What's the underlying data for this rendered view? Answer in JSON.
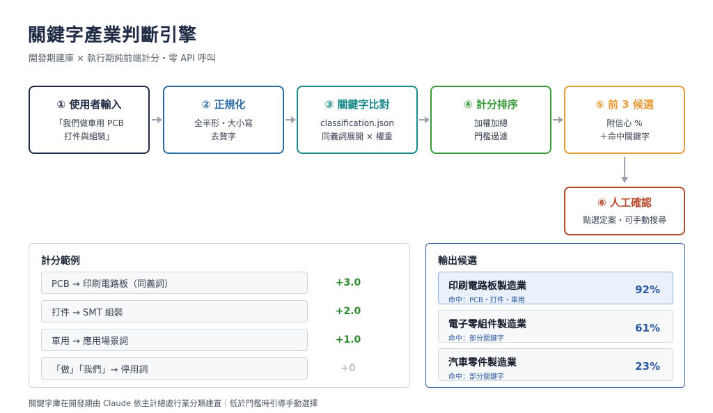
{
  "header": {
    "title": "關鍵字產業判斷引擎",
    "subtitle": "開發期建庫 × 執行期純前端計分・零 API 呼叫"
  },
  "colors": {
    "step1": "#1f2a44",
    "step2": "#2e6da4",
    "step3": "#1a8a8a",
    "step4": "#3a9a3a",
    "step5": "#e69a38",
    "step6": "#b5492c",
    "arrow": "#9ca3af",
    "positive": "#2f8a2f",
    "neutral": "#9aa0a6",
    "output_border": "#2c5aa0",
    "output_accent": "#2c5aa0"
  },
  "steps": [
    {
      "title": "① 使用者輸入",
      "lines": [
        "「我們做車用 PCB",
        "打件與組裝」"
      ]
    },
    {
      "title": "② 正規化",
      "lines": [
        "全半形・大小寫",
        "去贅字"
      ]
    },
    {
      "title": "③ 關鍵字比對",
      "lines": [
        "classification.json",
        "同義詞展開 × 權重"
      ]
    },
    {
      "title": "④ 計分排序",
      "lines": [
        "加權加總",
        "門檻過濾"
      ]
    },
    {
      "title": "⑤ 前 3 候選",
      "lines": [
        "附信心 %",
        "＋命中關鍵字"
      ]
    },
    {
      "title": "⑥ 人工確認",
      "lines": [
        "點選定案・可手動搜尋"
      ]
    }
  ],
  "scoring": {
    "heading": "計分範例",
    "rows": [
      {
        "rule": "PCB → 印刷電路板（同義詞）",
        "score": "+3.0"
      },
      {
        "rule": "打件 → SMT 組裝",
        "score": "+2.0"
      },
      {
        "rule": "車用 → 應用場景詞",
        "score": "+1.0"
      },
      {
        "rule": "「做」「我們」→ 停用詞",
        "score": "+0"
      }
    ]
  },
  "output": {
    "heading": "輸出候選",
    "candidates": [
      {
        "name": "印刷電路板製造業",
        "hit": "命中：PCB・打件・車用",
        "confidence": "92%"
      },
      {
        "name": "電子零組件製造業",
        "hit": "命中：部分關鍵字",
        "confidence": "61%"
      },
      {
        "name": "汽車零件製造業",
        "hit": "命中：部分關鍵字",
        "confidence": "23%"
      }
    ]
  },
  "footnote": "關鍵字庫在開發期由 Claude 依主計總處行業分類建置｜低於門檻時引導手動選擇"
}
